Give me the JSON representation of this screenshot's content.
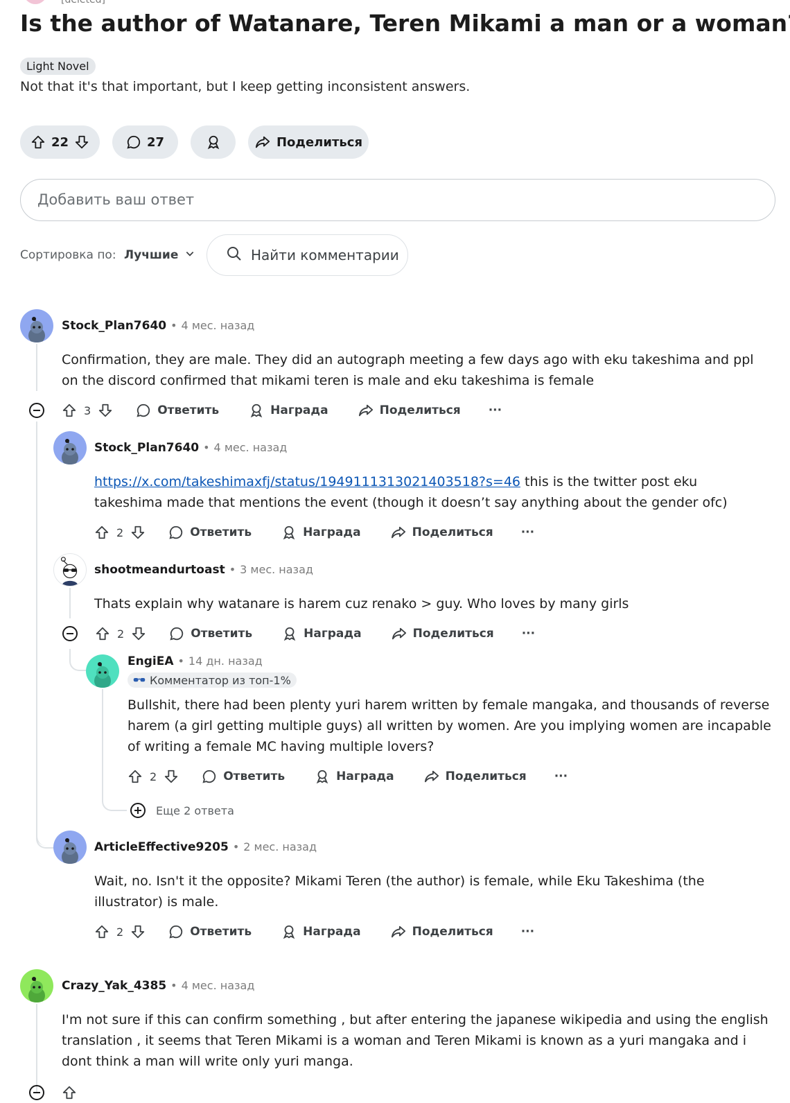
{
  "post": {
    "top_author": "[deleted]",
    "title": "Is the author of Watanare, Teren Mikami a man or a woman?",
    "flair": "Light Novel",
    "body": "Not that it's that important, but I keep getting inconsistent answers.",
    "votes": "22",
    "comments": "27",
    "share_label": "Поделиться"
  },
  "answer_placeholder": "Добавить ваш ответ",
  "sort": {
    "label": "Сортировка по:",
    "value": "Лучшие"
  },
  "search_placeholder": "Найти комментарии",
  "labels": {
    "reply": "Ответить",
    "award": "Награда",
    "share": "Поделиться",
    "more": "···"
  },
  "comments": [
    {
      "author": "Stock_Plan7640",
      "time": "4 мес. назад",
      "text": "Confirmation, they are male. They did an autograph meeting a few days ago with eku takeshima and ppl on the discord confirmed that mikami teren is male and eku takeshima is female",
      "votes": "3",
      "avatar_color": "#8fa7f0"
    },
    {
      "author": "Stock_Plan7640",
      "time": "4 мес. назад",
      "link": "https://x.com/takeshimaxfj/status/1949111313021403518?s=46",
      "text": " this is the twitter post eku takeshima made that mentions the event (though it doesn’t say anything about the gender ofc)",
      "votes": "2",
      "avatar_color": "#8fa7f0"
    },
    {
      "author": "shootmeandurtoast",
      "time": "3 мес. назад",
      "text": "Thats explain why watanare is harem cuz renako > guy. Who loves by many girls",
      "votes": "2",
      "avatar_color": "#ffffff"
    },
    {
      "author": "EngiEA",
      "time": "14 дн. назад",
      "badge": "Комментатор из топ-1%",
      "text": "Bullshit, there had been plenty yuri harem written by female mangaka, and thousands of reverse harem (a girl getting multiple guys) all written by women. Are you implying women are incapable of writing a female MC having multiple lovers?",
      "votes": "2",
      "avatar_color": "#4fe0bf",
      "more_replies": "Еще 2 ответа"
    },
    {
      "author": "ArticleEffective9205",
      "time": "2 мес. назад",
      "text": "Wait, no. Isn't it the opposite? Mikami Teren (the author) is female, while Eku Takeshima (the illustrator) is male.",
      "votes": "2",
      "avatar_color": "#8fa7f0"
    },
    {
      "author": "Crazy_Yak_4385",
      "time": "4 мес. назад",
      "text": "I'm not sure if this can confirm something , but after entering the japanese wikipedia and using the english translation , it seems that Teren Mikami is a woman and Teren Mikami is known as a yuri mangaka and i dont think a man will write only yuri manga.",
      "avatar_color": "#8fe85c"
    }
  ]
}
